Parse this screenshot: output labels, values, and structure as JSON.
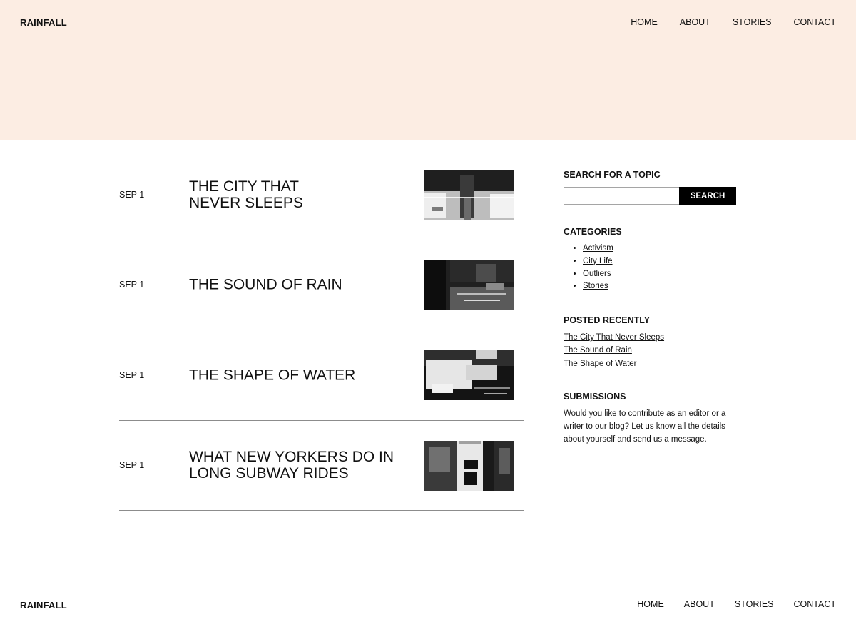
{
  "site": {
    "brand": "RAINFALL"
  },
  "nav": {
    "items": [
      "HOME",
      "ABOUT",
      "STORIES",
      "CONTACT"
    ]
  },
  "posts": [
    {
      "date": "SEP 1",
      "title": "THE CITY THAT\nNEVER SLEEPS",
      "image": "rainy-street-reflection"
    },
    {
      "date": "SEP 1",
      "title": "THE SOUND OF RAIN",
      "image": "feet-in-puddle"
    },
    {
      "date": "SEP 1",
      "title": "THE SHAPE OF WATER",
      "image": "hands-catching-water"
    },
    {
      "date": "SEP 1",
      "title": "WHAT NEW YORKERS DO IN\nLONG SUBWAY RIDES",
      "image": "subway-crowd"
    }
  ],
  "sidebar": {
    "search": {
      "heading": "SEARCH FOR A TOPIC",
      "value": "",
      "placeholder": "",
      "button_label": "SEARCH"
    },
    "categories": {
      "heading": "CATEGORIES",
      "items": [
        "Activism",
        "City Life",
        "Outliers",
        "Stories"
      ]
    },
    "recent": {
      "heading": "POSTED RECENTLY",
      "items": [
        "The City That Never Sleeps",
        "The Sound of Rain",
        "The Shape of Water"
      ]
    },
    "submissions": {
      "heading": "SUBMISSIONS",
      "text": "Would you like to contribute as an editor or a writer to our blog? Let us know all the details about yourself and send us a message."
    }
  },
  "footer": {
    "brand": "RAINFALL",
    "nav": [
      "HOME",
      "ABOUT",
      "STORIES",
      "CONTACT"
    ]
  },
  "colors": {
    "hero_background": "#fcede3",
    "button_background": "#000000",
    "divider": "#8c8c8c"
  }
}
